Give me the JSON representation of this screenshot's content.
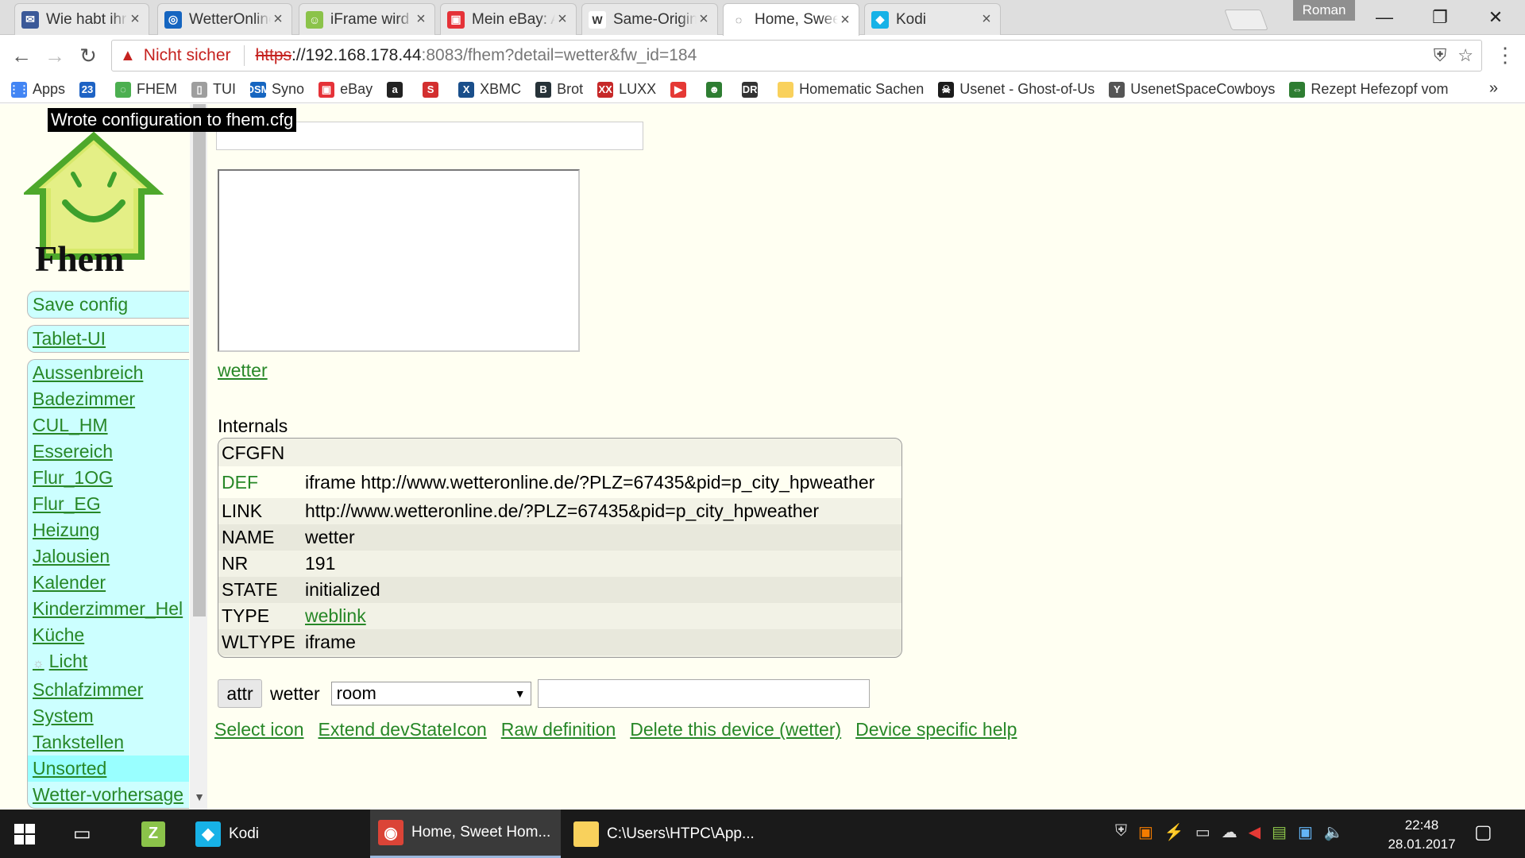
{
  "browser": {
    "tabs": [
      {
        "title": "Wie habt ihr Ko",
        "favicon": "forum-icon",
        "color": "#3b5998",
        "glyph": "✉"
      },
      {
        "title": "WetterOnline W",
        "favicon": "globe-icon",
        "color": "#1565c0",
        "glyph": "◎"
      },
      {
        "title": "iFrame wird nicl",
        "favicon": "fhem-forum-icon",
        "color": "#8bc34a",
        "glyph": "☺"
      },
      {
        "title": "Mein eBay: Artik",
        "favicon": "ebay-icon",
        "color": "#e53238",
        "glyph": "▣"
      },
      {
        "title": "Same-Origin-Po",
        "favicon": "wikipedia-icon",
        "color": "#fff",
        "glyph": "W"
      },
      {
        "title": "Home, Sweet H",
        "favicon": "fhem-icon",
        "color": "#fff",
        "glyph": "◌"
      },
      {
        "title": "Kodi",
        "favicon": "kodi-icon",
        "color": "#17b2e7",
        "glyph": "◆"
      }
    ],
    "profile_name": "Roman",
    "address": {
      "security_label": "Nicht sicher",
      "scheme": "https",
      "host": "://192.168.178.44",
      "rest": ":8083/fhem?detail=wetter&fw_id=184"
    },
    "bookmarks": [
      {
        "label": "Apps",
        "icon": "apps-grid-icon",
        "color": "#4285f4",
        "glyph": "⋮⋮"
      },
      {
        "label": "",
        "icon": "calendar-icon",
        "color": "#1e63c4",
        "glyph": "23"
      },
      {
        "label": "FHEM",
        "icon": "fhem-icon",
        "color": "#4caf50",
        "glyph": "◌"
      },
      {
        "label": "TUI",
        "icon": "page-icon",
        "color": "#9e9e9e",
        "glyph": "▯"
      },
      {
        "label": "Syno",
        "icon": "synology-icon",
        "color": "#1565c0",
        "glyph": "DSM"
      },
      {
        "label": "eBay",
        "icon": "ebay-icon",
        "color": "#e53238",
        "glyph": "▣"
      },
      {
        "label": "",
        "icon": "amazon-icon",
        "color": "#222",
        "glyph": "a"
      },
      {
        "label": "",
        "icon": "s-icon",
        "color": "#d32f2f",
        "glyph": "S"
      },
      {
        "label": "XBMC",
        "icon": "xbmc-icon",
        "color": "#1a4f8b",
        "glyph": "X"
      },
      {
        "label": "Brot",
        "icon": "bread-icon",
        "color": "#263238",
        "glyph": "B"
      },
      {
        "label": "LUXX",
        "icon": "luxx-icon",
        "color": "#c62828",
        "glyph": "XX"
      },
      {
        "label": "",
        "icon": "youtube-icon",
        "color": "#e53935",
        "glyph": "▶"
      },
      {
        "label": "",
        "icon": "frog-icon",
        "color": "#2e7d32",
        "glyph": "☻"
      },
      {
        "label": "",
        "icon": "dr-icon",
        "color": "#333",
        "glyph": "DR"
      },
      {
        "label": "Homematic Sachen",
        "icon": "folder-icon",
        "color": "#f9d15c",
        "glyph": ""
      },
      {
        "label": "Usenet - Ghost-of-Us",
        "icon": "alien-icon",
        "color": "#1b1b1b",
        "glyph": "☠"
      },
      {
        "label": "UsenetSpaceCowboys",
        "icon": "cowboy-icon",
        "color": "#555",
        "glyph": "Y"
      },
      {
        "label": "Rezept Hefezopf vom",
        "icon": "link-icon",
        "color": "#2e7d32",
        "glyph": "⇔"
      }
    ],
    "more_glyph": "»"
  },
  "page": {
    "toast": "Wrote configuration to fhem.cfg",
    "logo_text": "Fhem",
    "menu_top": [
      "Save config",
      "Tablet-UI"
    ],
    "rooms": [
      "Aussenbreich",
      "Badezimmer",
      "CUL_HM",
      "Essereich",
      "Flur_1OG",
      "Flur_EG",
      "Heizung",
      "Jalousien",
      "Kalender",
      "Kinderzimmer_Hel",
      "Küche",
      "Licht",
      "Schlafzimmer",
      "System",
      "Tankstellen",
      "Unsorted",
      "Wetter-vorhersage"
    ],
    "selected_room": "Unsorted",
    "weblink": "wetter",
    "internals_heading": "Internals",
    "internals": [
      {
        "key": "CFGFN",
        "value": ""
      },
      {
        "key": "DEF",
        "value": "iframe http://www.wetteronline.de/?PLZ=67435&pid=p_city_hpweather"
      },
      {
        "key": "LINK",
        "value": "http://www.wetteronline.de/?PLZ=67435&pid=p_city_hpweather"
      },
      {
        "key": "NAME",
        "value": "wetter"
      },
      {
        "key": "NR",
        "value": "191"
      },
      {
        "key": "STATE",
        "value": "initialized"
      },
      {
        "key": "TYPE",
        "value": "weblink"
      },
      {
        "key": "WLTYPE",
        "value": "iframe"
      }
    ],
    "attr": {
      "button": "attr",
      "device": "wetter",
      "selected": "room",
      "value": ""
    },
    "actions": [
      "Select icon",
      "Extend devStateIcon",
      "Raw definition",
      "Delete this device (wetter)",
      "Device specific help"
    ]
  },
  "taskbar": {
    "items": [
      {
        "label": "",
        "icon": "zotero-icon",
        "color": "#8bc34a",
        "glyph": "Z"
      },
      {
        "label": "Kodi",
        "icon": "kodi-icon",
        "color": "#17b2e7",
        "glyph": "◆"
      },
      {
        "label": "Home, Sweet Hom...",
        "icon": "chrome-icon",
        "color": "#db4437",
        "glyph": "◉"
      },
      {
        "label": "C:\\Users\\HTPC\\App...",
        "icon": "folder-icon",
        "color": "#f9d15c",
        "glyph": ""
      }
    ],
    "time": "22:48",
    "date": "28.01.2017"
  },
  "colors": {
    "fhem_green": "#278727",
    "menu_bg": "#ccffff",
    "page_bg": "#fffff2",
    "warning_red": "#c5221f"
  }
}
